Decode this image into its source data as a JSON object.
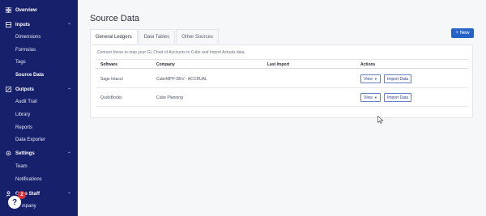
{
  "sidebar": {
    "overview": {
      "label": "Overview",
      "icon": "grid-icon"
    },
    "inputs": {
      "label": "Inputs",
      "icon": "inputs-icon",
      "items": [
        {
          "label": "Dimensions"
        },
        {
          "label": "Formulas"
        },
        {
          "label": "Tags"
        },
        {
          "label": "Source Data",
          "active": true
        }
      ]
    },
    "outputs": {
      "label": "Outputs",
      "icon": "outputs-icon",
      "items": [
        {
          "label": "Audit Trail"
        },
        {
          "label": "Library"
        },
        {
          "label": "Reports"
        },
        {
          "label": "Data Exporter"
        }
      ]
    },
    "settings": {
      "label": "Settings",
      "icon": "gear-icon",
      "items": [
        {
          "label": "Team"
        },
        {
          "label": "Notifications"
        }
      ]
    },
    "cube_staff": {
      "label": "Cube Staff",
      "icon": "staff-icon",
      "items": [
        {
          "label": "Company"
        }
      ]
    }
  },
  "help": {
    "glyph": "?",
    "count": "2"
  },
  "page": {
    "title": "Source Data",
    "new_button": "+ New"
  },
  "tabs": [
    {
      "label": "General Ledgers",
      "active": true
    },
    {
      "label": "Data Tables"
    },
    {
      "label": "Other Sources"
    }
  ],
  "card": {
    "description": "Connect these to map your GL Chart of Accounts to Cube and Import Actuals data.",
    "columns": [
      "Software",
      "Company",
      "Last Import",
      "Actions"
    ],
    "rows": [
      {
        "software": "Sage Intacct",
        "company": "CubeMPP-DEV - ACCRUAL",
        "last_import": "",
        "view": "View",
        "import": "Import Data"
      },
      {
        "software": "QuickBooks",
        "company": "Cube Planning",
        "last_import": "",
        "view": "View",
        "import": "Import Data"
      }
    ]
  },
  "colors": {
    "sidebar": "#17206b",
    "accent": "#2563c9",
    "badge": "#d8313a"
  }
}
